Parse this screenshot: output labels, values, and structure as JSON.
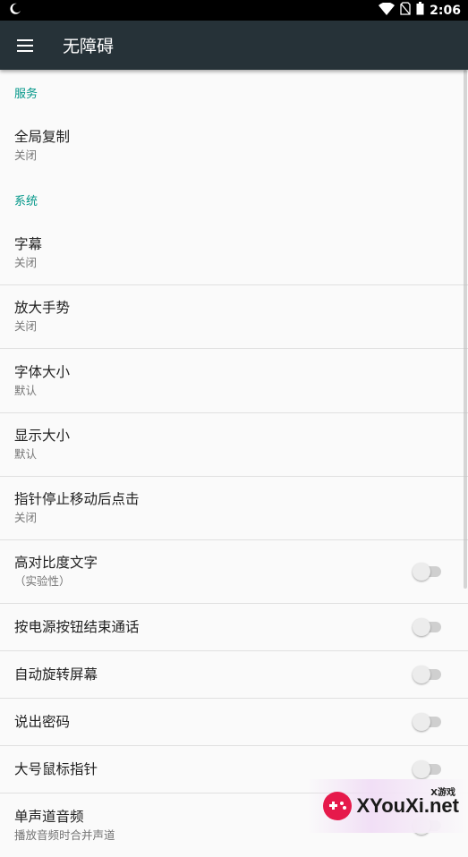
{
  "status_bar": {
    "time": "2:06",
    "icons": [
      "moon-icon",
      "wifi-icon",
      "no-sim-icon",
      "battery-icon"
    ]
  },
  "toolbar": {
    "title": "无障碍",
    "menu_icon": "hamburger-menu-icon"
  },
  "sections": [
    {
      "category": "服务",
      "items": [
        {
          "title": "全局复制",
          "summary": "关闭"
        }
      ]
    },
    {
      "category": "系统",
      "items": [
        {
          "title": "字幕",
          "summary": "关闭"
        },
        {
          "title": "放大手势",
          "summary": "关闭"
        },
        {
          "title": "字体大小",
          "summary": "默认"
        },
        {
          "title": "显示大小",
          "summary": "默认"
        },
        {
          "title": "指针停止移动后点击",
          "summary": "关闭"
        },
        {
          "title": "高对比度文字",
          "summary": "（实验性）",
          "switch": false
        },
        {
          "title": "按电源按钮结束通话",
          "switch": false
        },
        {
          "title": "自动旋转屏幕",
          "switch": false
        },
        {
          "title": "说出密码",
          "switch": false
        },
        {
          "title": "大号鼠标指针",
          "switch": false
        },
        {
          "title": "单声道音频",
          "summary": "播放音频时合并声道",
          "switch": false
        }
      ]
    }
  ],
  "watermark": {
    "text": "XYouXi.net",
    "sub": "X游戏"
  },
  "colors": {
    "toolbar": "#263238",
    "accent": "#009688",
    "status_bar": "#000000"
  }
}
